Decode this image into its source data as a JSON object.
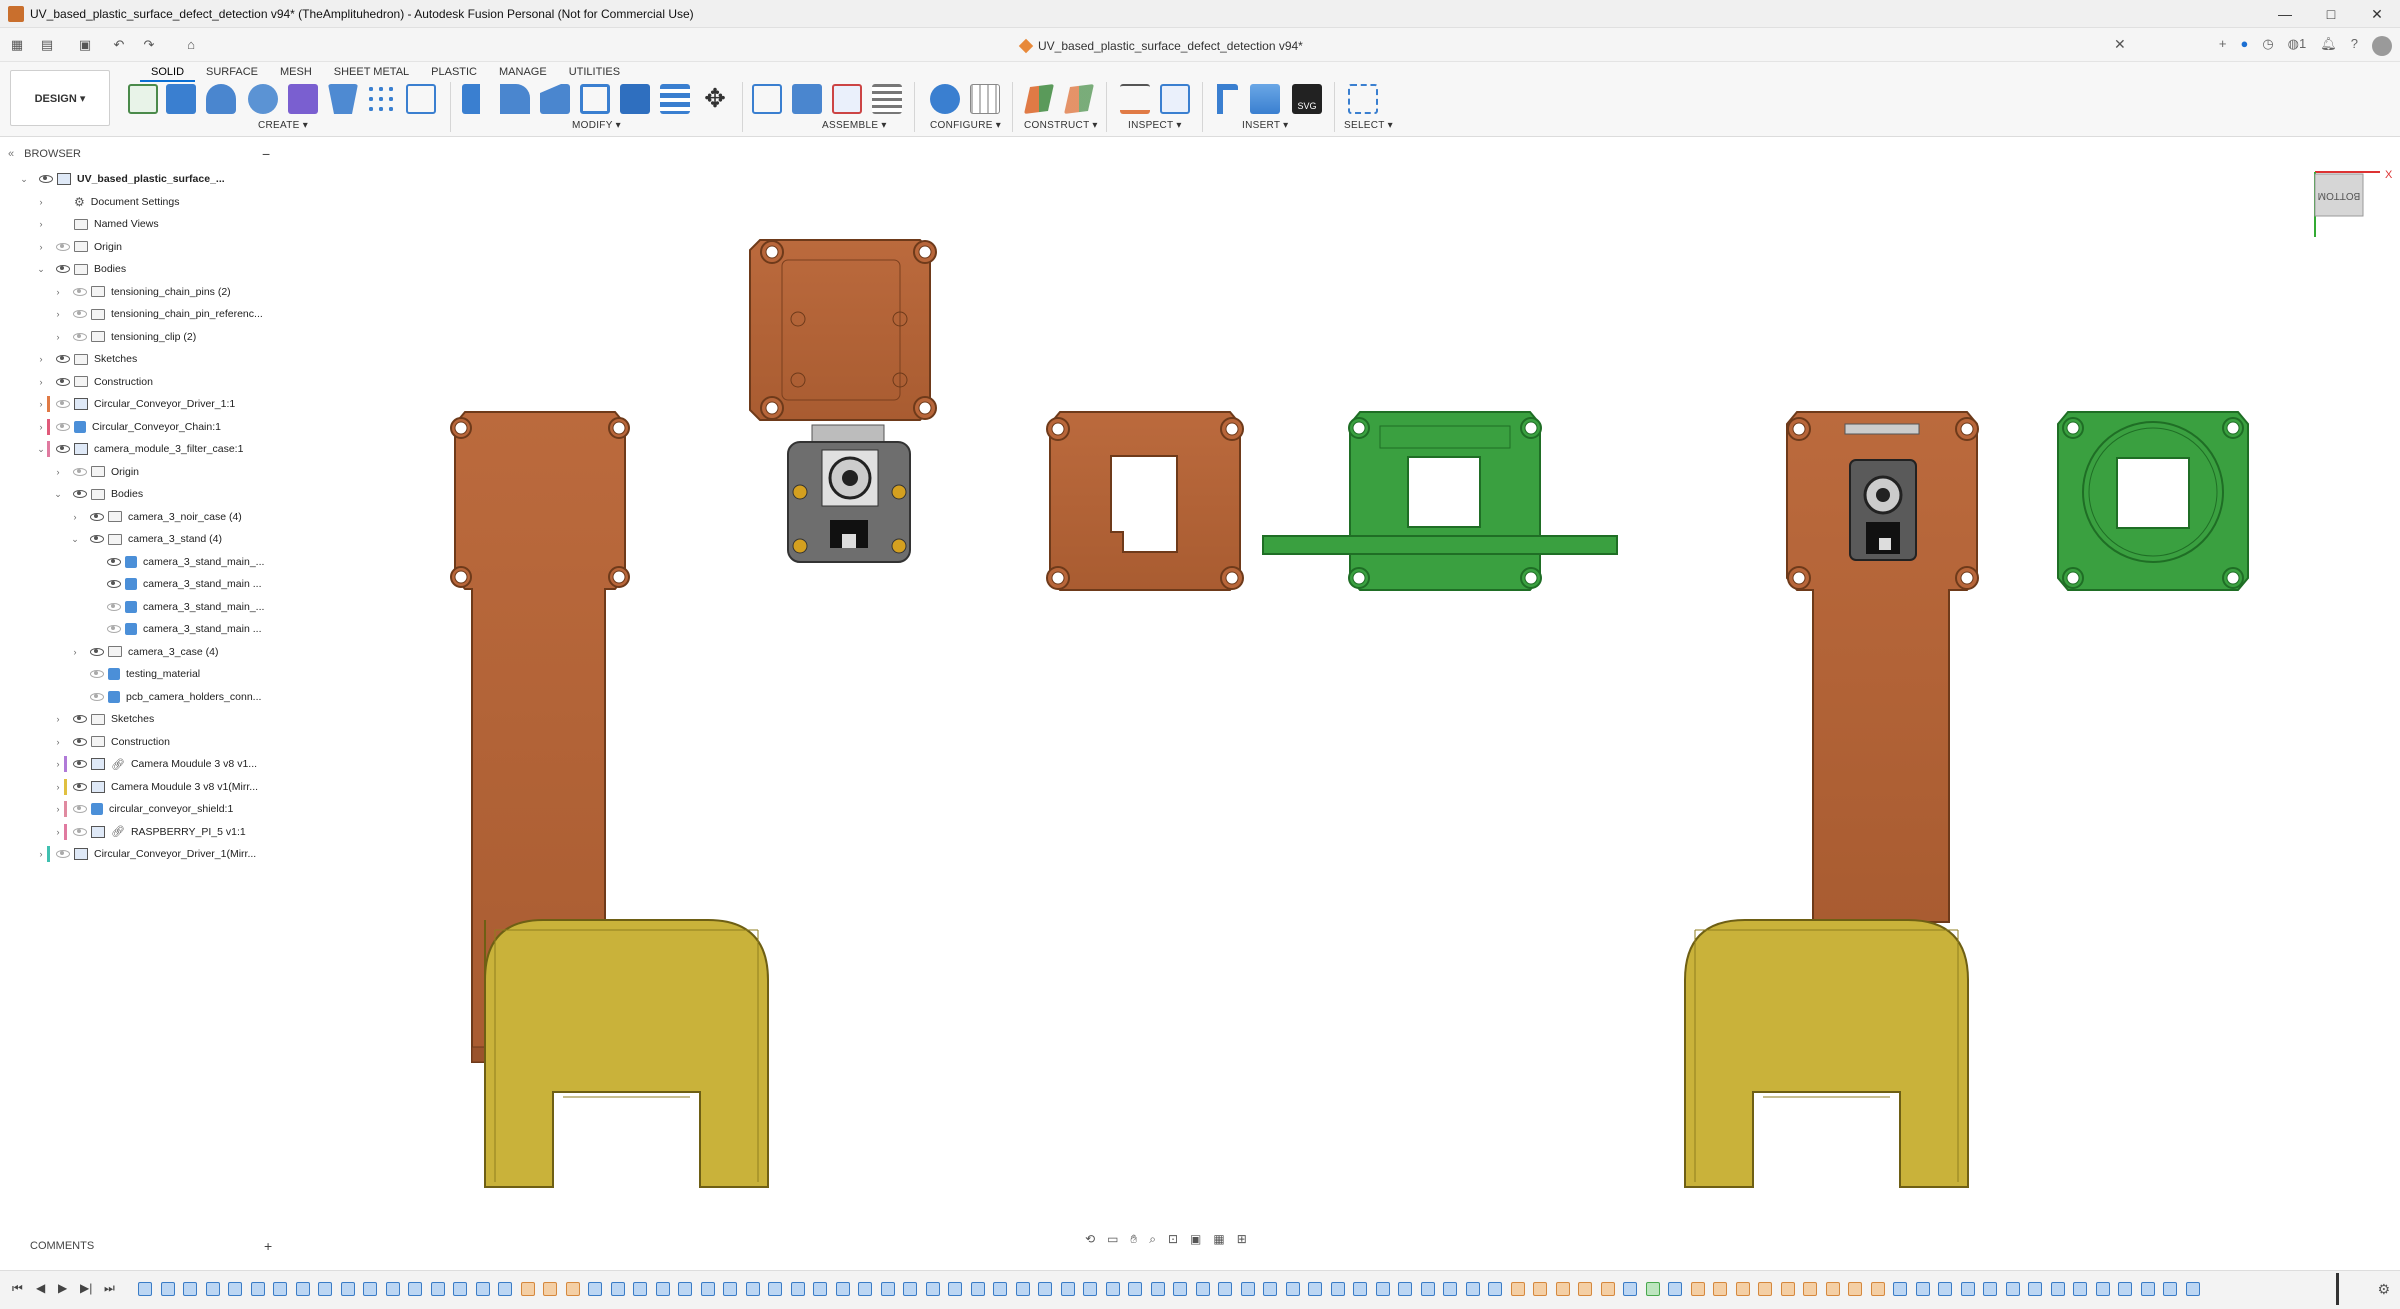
{
  "window": {
    "title": "UV_based_plastic_surface_defect_detection v94* (TheAmplituhedron) - Autodesk Fusion Personal (Not for Commercial Use)",
    "controls": [
      "—",
      "□",
      "✕"
    ]
  },
  "document_tab": {
    "label": "UV_based_plastic_surface_defect_detection v94*"
  },
  "workspace": {
    "label": "DESIGN ▾"
  },
  "ribbon": {
    "tabs": [
      "SOLID",
      "SURFACE",
      "MESH",
      "SHEET METAL",
      "PLASTIC",
      "MANAGE",
      "UTILITIES"
    ],
    "active_tab": "SOLID",
    "groups": [
      "CREATE ▾",
      "MODIFY ▾",
      "ASSEMBLE ▾",
      "CONFIGURE ▾",
      "CONSTRUCT ▾",
      "INSPECT ▾",
      "INSERT ▾",
      "SELECT ▾"
    ]
  },
  "browser": {
    "header": "BROWSER",
    "items": [
      {
        "label": "UV_based_plastic_surface_...",
        "level": 0,
        "chev": "⌄",
        "icon": "comp",
        "eye": true,
        "bold": true
      },
      {
        "label": "Document Settings",
        "level": 1,
        "chev": "›",
        "icon": "gear",
        "eye": null
      },
      {
        "label": "Named Views",
        "level": 1,
        "chev": "›",
        "icon": "folder",
        "eye": null
      },
      {
        "label": "Origin",
        "level": 1,
        "chev": "›",
        "icon": "folder",
        "eye": false
      },
      {
        "label": "Bodies",
        "level": 1,
        "chev": "⌄",
        "icon": "folder",
        "eye": true
      },
      {
        "label": "tensioning_chain_pins (2)",
        "level": 2,
        "chev": "›",
        "icon": "folder",
        "eye": false
      },
      {
        "label": "tensioning_chain_pin_referenc...",
        "level": 2,
        "chev": "›",
        "icon": "folder",
        "eye": false
      },
      {
        "label": "tensioning_clip (2)",
        "level": 2,
        "chev": "›",
        "icon": "folder",
        "eye": false
      },
      {
        "label": "Sketches",
        "level": 1,
        "chev": "›",
        "icon": "folder",
        "eye": true
      },
      {
        "label": "Construction",
        "level": 1,
        "chev": "›",
        "icon": "folder",
        "eye": true
      },
      {
        "label": "Circular_Conveyor_Driver_1:1",
        "level": 1,
        "chev": "›",
        "icon": "comp",
        "eye": false,
        "color": "#e07a45"
      },
      {
        "label": "Circular_Conveyor_Chain:1",
        "level": 1,
        "chev": "›",
        "icon": "body",
        "eye": false,
        "color": "#e05a7a"
      },
      {
        "label": "camera_module_3_filter_case:1",
        "level": 1,
        "chev": "⌄",
        "icon": "comp",
        "eye": true,
        "color": "#e07aa0"
      },
      {
        "label": "Origin",
        "level": 2,
        "chev": "›",
        "icon": "folder",
        "eye": false
      },
      {
        "label": "Bodies",
        "level": 2,
        "chev": "⌄",
        "icon": "folder",
        "eye": true
      },
      {
        "label": "camera_3_noir_case (4)",
        "level": 3,
        "chev": "›",
        "icon": "folder",
        "eye": true
      },
      {
        "label": "camera_3_stand (4)",
        "level": 3,
        "chev": "⌄",
        "icon": "folder",
        "eye": true
      },
      {
        "label": "camera_3_stand_main_...",
        "level": 4,
        "chev": "",
        "icon": "body",
        "eye": true
      },
      {
        "label": "camera_3_stand_main ...",
        "level": 4,
        "chev": "",
        "icon": "body",
        "eye": true
      },
      {
        "label": "camera_3_stand_main_...",
        "level": 4,
        "chev": "",
        "icon": "body",
        "eye": false
      },
      {
        "label": "camera_3_stand_main ...",
        "level": 4,
        "chev": "",
        "icon": "body",
        "eye": false
      },
      {
        "label": "camera_3_case (4)",
        "level": 3,
        "chev": "›",
        "icon": "folder",
        "eye": true
      },
      {
        "label": "testing_material",
        "level": 3,
        "chev": "",
        "icon": "body",
        "eye": false
      },
      {
        "label": "pcb_camera_holders_conn...",
        "level": 3,
        "chev": "",
        "icon": "body",
        "eye": false
      },
      {
        "label": "Sketches",
        "level": 2,
        "chev": "›",
        "icon": "folder",
        "eye": true
      },
      {
        "label": "Construction",
        "level": 2,
        "chev": "›",
        "icon": "folder",
        "eye": true
      },
      {
        "label": "Camera Moudule 3 v8 v1...",
        "level": 2,
        "chev": "›",
        "icon": "comp",
        "eye": true,
        "color": "#b07ad8",
        "link": true
      },
      {
        "label": "Camera Moudule 3 v8 v1(Mirr...",
        "level": 2,
        "chev": "›",
        "icon": "comp",
        "eye": true,
        "color": "#e0c040"
      },
      {
        "label": "circular_conveyor_shield:1",
        "level": 2,
        "chev": "›",
        "icon": "body",
        "eye": false,
        "color": "#e08aa0"
      },
      {
        "label": "RASPBERRY_PI_5 v1:1",
        "level": 2,
        "chev": "›",
        "icon": "comp",
        "eye": false,
        "color": "#e07aa0",
        "link": true
      },
      {
        "label": "Circular_Conveyor_Driver_1(Mirr...",
        "level": 1,
        "chev": "›",
        "icon": "comp",
        "eye": false,
        "color": "#40c0b0"
      }
    ]
  },
  "viewcube": {
    "face": "BOTTOM",
    "axis": "X"
  },
  "comments": {
    "label": "COMMENTS",
    "add": "+"
  },
  "colors": {
    "copper": "#b8663a",
    "copper_dark": "#8d4c27",
    "green": "#3aa040",
    "green_dark": "#1f6e25",
    "yellow": "#c9b23a",
    "yellow_dark": "#8f7d1e",
    "accent": "#0a6fd3"
  }
}
